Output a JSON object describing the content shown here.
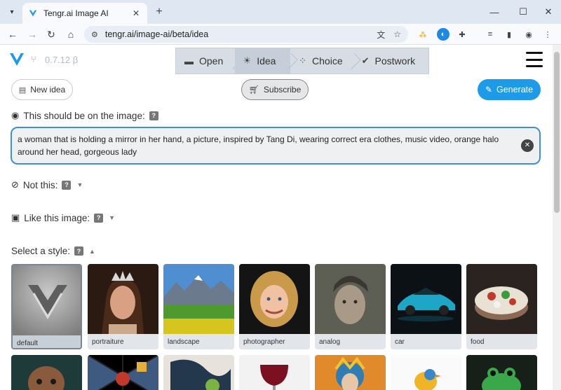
{
  "browser": {
    "tab_title": "Tengr.ai Image AI",
    "url": "tengr.ai/image-ai/beta/idea",
    "ext_badge": "5"
  },
  "app": {
    "version": "0.7.12 β",
    "steps": [
      {
        "label": "Open"
      },
      {
        "label": "Idea"
      },
      {
        "label": "Choice"
      },
      {
        "label": "Postwork"
      }
    ],
    "new_idea_label": "New idea",
    "subscribe_label": "Subscribe",
    "generate_label": "Generate",
    "prompt_label": "This should be on the image:",
    "prompt_value": "a woman that is holding a mirror in her hand, a picture, inspired by Tang Di, wearing correct era clothes, music video, orange halo around her head, gorgeous lady",
    "not_this_label": "Not this:",
    "like_image_label": "Like this image:",
    "style_label": "Select a style:",
    "help_glyph": "?",
    "styles": [
      {
        "label": "default"
      },
      {
        "label": "portraiture"
      },
      {
        "label": "landscape"
      },
      {
        "label": "photographer"
      },
      {
        "label": "analog"
      },
      {
        "label": "car"
      },
      {
        "label": "food"
      }
    ],
    "accent_color": "#1e9be8"
  }
}
